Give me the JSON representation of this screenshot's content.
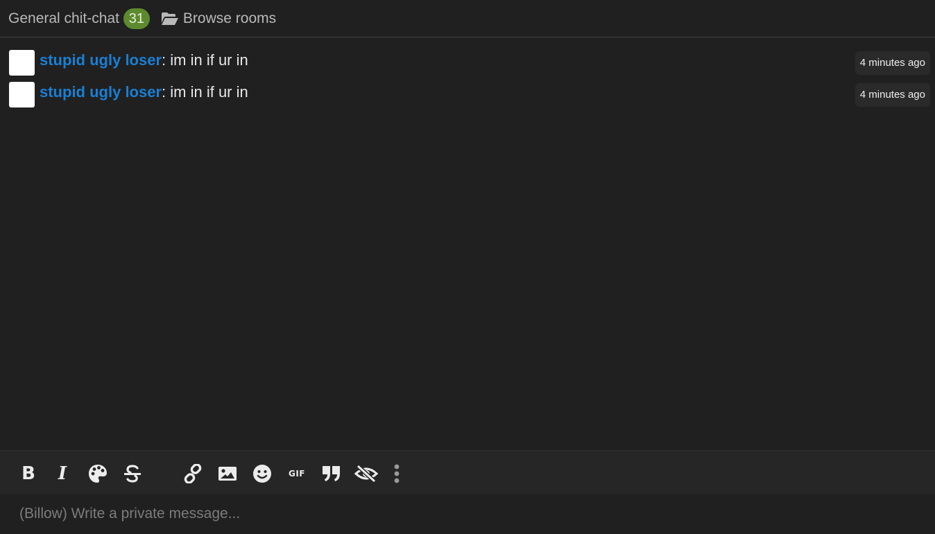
{
  "header": {
    "room_title": "General chit-chat",
    "unread_count": "31",
    "browse_label": "Browse rooms",
    "badge_color": "#5d8a2e"
  },
  "messages": [
    {
      "author": "stupid ugly loser",
      "separator": ": ",
      "text": "im in if ur in",
      "time": "4 minutes ago"
    },
    {
      "author": "stupid ugly loser",
      "separator": ": ",
      "text": "im in if ur in",
      "time": "4 minutes ago"
    }
  ],
  "colors": {
    "author_link": "#1a7fd4",
    "background": "#202020",
    "toolbar_background": "#262626"
  },
  "toolbar": {
    "tools": [
      "bold-icon",
      "italic-icon",
      "palette-icon",
      "strikethrough-icon",
      "link-icon",
      "image-icon",
      "emoji-icon",
      "gif-icon",
      "quote-icon",
      "hidden-eye-icon",
      "more-icon"
    ],
    "bold_label": "B",
    "italic_label": "I",
    "gif_label": "GIF"
  },
  "composer": {
    "placeholder": "(Billow) Write a private message..."
  }
}
